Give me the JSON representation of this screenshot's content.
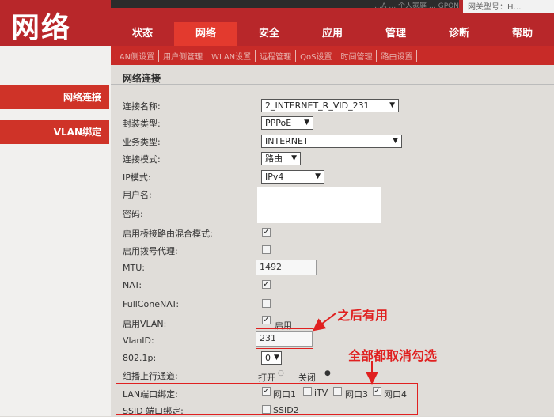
{
  "brand": {
    "logo_text": "网络"
  },
  "header": {
    "top_strip_text": "…A … 个人家庭 … GPON",
    "top_right_text": "网关型号：H…"
  },
  "tabs": [
    {
      "label": "状态"
    },
    {
      "label": "网络"
    },
    {
      "label": "安全"
    },
    {
      "label": "应用"
    },
    {
      "label": "管理"
    },
    {
      "label": "诊断"
    },
    {
      "label": "帮助"
    }
  ],
  "subnav": [
    "LAN侧设置",
    "用户侧管理",
    "WLAN设置",
    "远程管理",
    "QoS设置",
    "时间管理",
    "路由设置"
  ],
  "sidebar": [
    {
      "label": "网络连接"
    },
    {
      "label": "VLAN绑定"
    }
  ],
  "section": {
    "title": "网络连接"
  },
  "form": {
    "connection_name": {
      "label": "连接名称:",
      "value": "2_INTERNET_R_VID_231"
    },
    "encap_type": {
      "label": "封装类型:",
      "value": "PPPoE"
    },
    "service_type": {
      "label": "业务类型:",
      "value": "INTERNET"
    },
    "conn_mode": {
      "label": "连接模式:",
      "value": "路由"
    },
    "ip_mode": {
      "label": "IP模式:",
      "value": "IPv4"
    },
    "username": {
      "label": "用户名:"
    },
    "password": {
      "label": "密码:"
    },
    "bridge_route_mix": {
      "label": "启用桥接路由混合模式:",
      "checked": true
    },
    "dial_proxy": {
      "label": "启用拨号代理:",
      "checked": false
    },
    "mtu": {
      "label": "MTU:",
      "value": "1492"
    },
    "nat": {
      "label": "NAT:",
      "checked": true
    },
    "fullcone_nat": {
      "label": "FullConeNAT:",
      "checked": false
    },
    "enable_vlan": {
      "label": "启用VLAN:",
      "checked": true,
      "option_text": "启用"
    },
    "vlan_id": {
      "label": "VlanID:",
      "value": "231"
    },
    "dot1p": {
      "label": "802.1p:",
      "value": "0"
    },
    "multicast_upstream": {
      "label": "组播上行通道:",
      "on_text": "打开",
      "off_text": "关闭"
    },
    "lan_bind": {
      "label": "LAN端口绑定:",
      "ports": [
        {
          "text": "网口1",
          "checked": true
        },
        {
          "text": "iTV",
          "checked": false
        },
        {
          "text": "网口3",
          "checked": false
        },
        {
          "text": "网口4",
          "checked": true
        }
      ]
    },
    "ssid_bind": {
      "label": "SSID 端口绑定:",
      "ports": [
        {
          "text": "SSID2",
          "checked": false
        }
      ]
    }
  },
  "annotations": {
    "note_later_useful": "之后有用",
    "note_uncheck_all": "全部都取消勾选",
    "color": "#e02020"
  },
  "colors": {
    "brand_red": "#b8272a",
    "tab_active": "#e33a2e"
  }
}
